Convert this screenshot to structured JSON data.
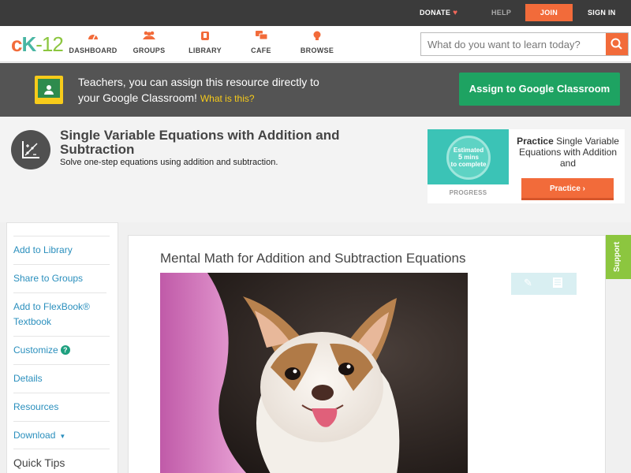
{
  "topbar": {
    "donate": "DONATE",
    "help": "HELP",
    "join": "JOIN",
    "signin": "SIGN IN"
  },
  "nav": {
    "logo_c": "c",
    "logo_k": "K",
    "logo_rest": "-12",
    "items": [
      {
        "label": "DASHBOARD",
        "icon": "dashboard-icon"
      },
      {
        "label": "GROUPS",
        "icon": "groups-icon"
      },
      {
        "label": "LIBRARY",
        "icon": "library-icon"
      },
      {
        "label": "CAFE",
        "icon": "cafe-icon"
      },
      {
        "label": "BROWSE",
        "icon": "browse-icon"
      }
    ],
    "search_placeholder": "What do you want to learn today?"
  },
  "banner": {
    "line1": "Teachers, you can assign this resource directly to",
    "line2": "your Google Classroom!",
    "what": "What is this?",
    "assign_button": "Assign to Google Classroom"
  },
  "concept": {
    "title": "Single Variable Equations with Addition and Subtraction",
    "subtitle": "Solve one-step equations using addition and subtraction."
  },
  "practice": {
    "estimated": "Estimated",
    "mins_num": "5",
    "mins_label": "mins",
    "to_complete": "to complete",
    "progress": "PROGRESS",
    "bold": "Practice",
    "text": "Single Variable Equations with Addition and",
    "button": "Practice"
  },
  "sidebar": {
    "items": [
      "Add to Library",
      "Share to Groups",
      "Add to FlexBook® Textbook",
      "Customize",
      "Details",
      "Resources",
      "Download",
      "Quick Tips"
    ]
  },
  "content": {
    "title": "Mental Math for Addition and Subtraction Equations"
  },
  "support": "Support",
  "colors": {
    "accent": "#f26b3a",
    "green": "#1ea362",
    "teal": "#3bc3b6",
    "link": "#2a8fbd"
  }
}
